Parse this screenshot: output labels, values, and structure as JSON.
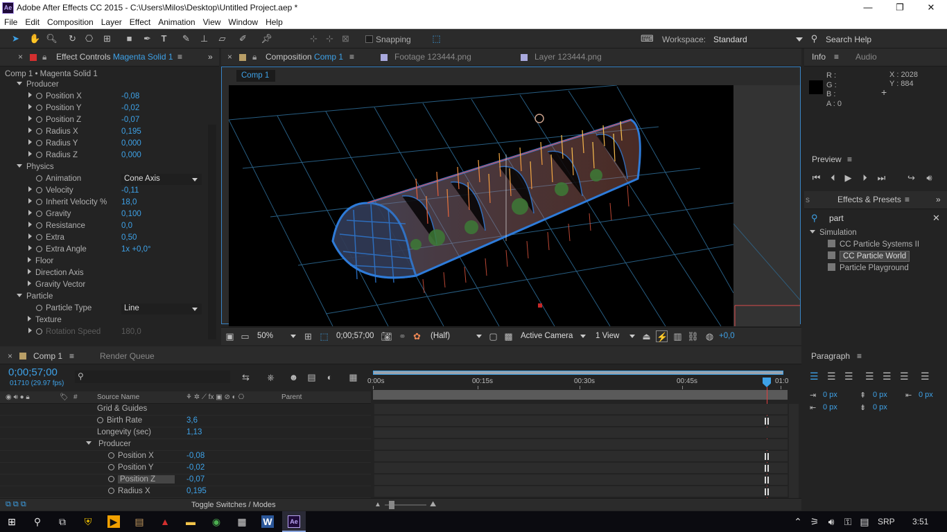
{
  "window": {
    "app_icon_label": "Ae",
    "title": "Adobe After Effects CC 2015 - C:\\Users\\Milos\\Desktop\\Untitled Project.aep *",
    "min": "—",
    "max": "❐",
    "close": "✕"
  },
  "menu": [
    "File",
    "Edit",
    "Composition",
    "Layer",
    "Effect",
    "Animation",
    "View",
    "Window",
    "Help"
  ],
  "toolbar": {
    "snapping": "Snapping",
    "workspace_label": "Workspace:",
    "workspace": "Standard",
    "search_help": "Search Help"
  },
  "effect_controls": {
    "tab_prefix": "Effect Controls",
    "tab_layer": "Magenta Solid 1",
    "breadcrumb": "Comp 1 • Magenta Solid 1",
    "rows": [
      {
        "label": "Producer",
        "value": "",
        "indent": 0,
        "twirl": "down",
        "stopwatch": false
      },
      {
        "label": "Position X",
        "value": "-0,08",
        "indent": 1,
        "twirl": "right",
        "stopwatch": true
      },
      {
        "label": "Position Y",
        "value": "-0,02",
        "indent": 1,
        "twirl": "right",
        "stopwatch": true
      },
      {
        "label": "Position Z",
        "value": "-0,07",
        "indent": 1,
        "twirl": "right",
        "stopwatch": true
      },
      {
        "label": "Radius X",
        "value": "0,195",
        "indent": 1,
        "twirl": "right",
        "stopwatch": true
      },
      {
        "label": "Radius Y",
        "value": "0,000",
        "indent": 1,
        "twirl": "right",
        "stopwatch": true
      },
      {
        "label": "Radius Z",
        "value": "0,000",
        "indent": 1,
        "twirl": "right",
        "stopwatch": true
      },
      {
        "label": "Physics",
        "value": "",
        "indent": 0,
        "twirl": "down",
        "stopwatch": false
      },
      {
        "label": "Animation",
        "value": "Cone Axis",
        "indent": 1,
        "twirl": "none",
        "stopwatch": true,
        "dropdown": true
      },
      {
        "label": "Velocity",
        "value": "-0,11",
        "indent": 1,
        "twirl": "right",
        "stopwatch": true
      },
      {
        "label": "Inherit Velocity %",
        "value": "18,0",
        "indent": 1,
        "twirl": "right",
        "stopwatch": true
      },
      {
        "label": "Gravity",
        "value": "0,100",
        "indent": 1,
        "twirl": "right",
        "stopwatch": true
      },
      {
        "label": "Resistance",
        "value": "0,0",
        "indent": 1,
        "twirl": "right",
        "stopwatch": true
      },
      {
        "label": "Extra",
        "value": "0,50",
        "indent": 1,
        "twirl": "right",
        "stopwatch": true
      },
      {
        "label": "Extra Angle",
        "value": "1x +0,0°",
        "indent": 1,
        "twirl": "right",
        "stopwatch": true
      },
      {
        "label": "Floor",
        "value": "",
        "indent": 0.6,
        "twirl": "right",
        "stopwatch": false
      },
      {
        "label": "Direction Axis",
        "value": "",
        "indent": 0.6,
        "twirl": "right",
        "stopwatch": false
      },
      {
        "label": "Gravity Vector",
        "value": "",
        "indent": 0.6,
        "twirl": "right",
        "stopwatch": false
      },
      {
        "label": "Particle",
        "value": "",
        "indent": 0,
        "twirl": "down",
        "stopwatch": false
      },
      {
        "label": "Particle Type",
        "value": "Line",
        "indent": 1,
        "twirl": "none",
        "stopwatch": true,
        "dropdown": true
      },
      {
        "label": "Texture",
        "value": "",
        "indent": 0.6,
        "twirl": "right",
        "stopwatch": false
      },
      {
        "label": "Rotation Speed",
        "value": "180,0",
        "indent": 1,
        "twirl": "right",
        "stopwatch": true,
        "dim": true
      }
    ]
  },
  "viewer_tabs": {
    "comp_prefix": "Composition",
    "comp_name": "Comp 1",
    "footage": "Footage 123444.png",
    "layer": "Layer 123444.png",
    "comp_chip": "Comp 1"
  },
  "viewer_bar": {
    "zoom": "50%",
    "timecode": "0;00;57;00",
    "resolution": "(Half)",
    "camera": "Active Camera",
    "views": "1 View",
    "exposure": "+0,0"
  },
  "info": {
    "tab": "Info",
    "tab2": "Audio",
    "r": "R :",
    "g": "G :",
    "b": "B :",
    "a": "A : 0",
    "x": "X : 2028",
    "y": "Y : 884"
  },
  "preview": {
    "title": "Preview"
  },
  "effects_presets": {
    "tab_left": "s",
    "title": "Effects & Presets",
    "search": "part",
    "category": "Simulation",
    "items": [
      "CC Particle Systems II",
      "CC Particle World",
      "Particle Playground"
    ],
    "selected_index": 1
  },
  "timeline": {
    "tab": "Comp 1",
    "tab2": "Render Queue",
    "timecode": "0;00;57;00",
    "frame_info": "01710 (29.97 fps)",
    "col_hash": "#",
    "col_source": "Source Name",
    "col_parent": "Parent",
    "ruler": [
      "0:00s",
      "00:15s",
      "00:30s",
      "00:45s",
      "01:0"
    ],
    "toggle_label": "Toggle Switches / Modes",
    "rows": [
      {
        "label": "Grid & Guides",
        "value": "",
        "indent": 0,
        "stopwatch": false,
        "twirl": "none"
      },
      {
        "label": "Birth Rate",
        "value": "3,6",
        "indent": 0,
        "stopwatch": true,
        "twirl": "none"
      },
      {
        "label": "Longevity (sec)",
        "value": "1,13",
        "indent": 0,
        "stopwatch": false,
        "twirl": "none"
      },
      {
        "label": "Producer",
        "value": "",
        "indent": 0,
        "stopwatch": false,
        "twirl": "down"
      },
      {
        "label": "Position X",
        "value": "-0,08",
        "indent": 1,
        "stopwatch": true,
        "twirl": "none"
      },
      {
        "label": "Position Y",
        "value": "-0,02",
        "indent": 1,
        "stopwatch": true,
        "twirl": "none"
      },
      {
        "label": "Position Z",
        "value": "-0,07",
        "indent": 1,
        "stopwatch": true,
        "twirl": "none",
        "selected": true
      },
      {
        "label": "Radius X",
        "value": "0,195",
        "indent": 1,
        "stopwatch": true,
        "twirl": "none"
      }
    ]
  },
  "paragraph": {
    "title": "Paragraph",
    "fields": [
      "0 px",
      "0 px",
      "0 px",
      "0 px",
      "0 px"
    ]
  },
  "taskbar": {
    "language": "SRP",
    "clock": "3:51"
  }
}
